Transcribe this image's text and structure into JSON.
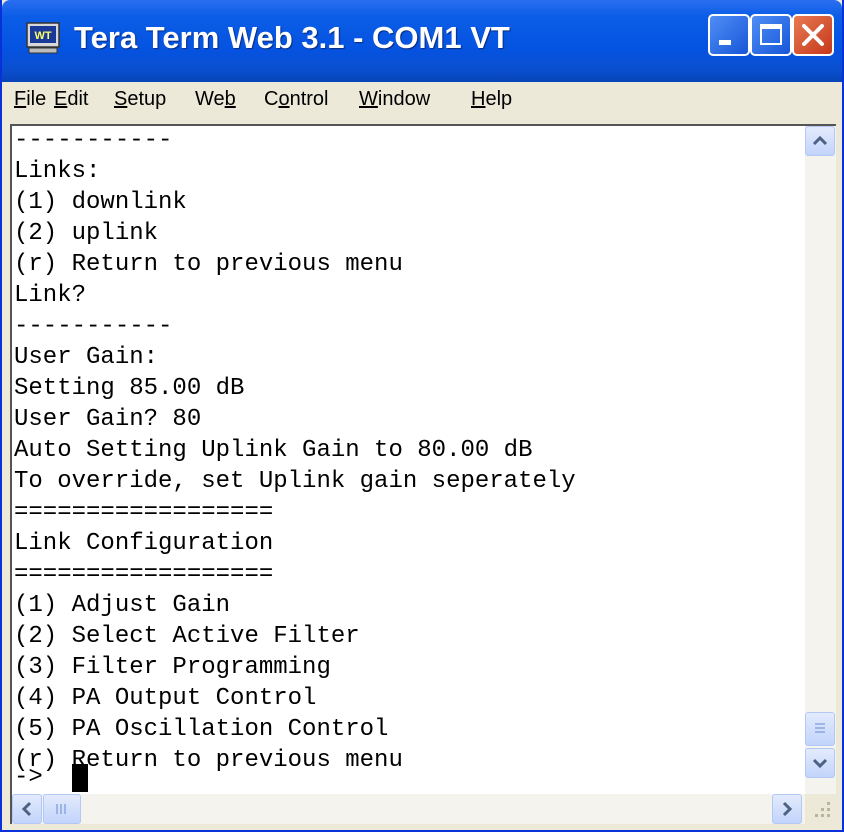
{
  "window": {
    "title": "Tera Term Web 3.1 - COM1 VT",
    "icon": "WT"
  },
  "menu": [
    {
      "pre": "",
      "ul": "F",
      "post": "ile"
    },
    {
      "pre": "",
      "ul": "E",
      "post": "dit"
    },
    {
      "pre": "",
      "ul": "S",
      "post": "etup"
    },
    {
      "pre": "We",
      "ul": "b",
      "post": ""
    },
    {
      "pre": "C",
      "ul": "o",
      "post": "ntrol"
    },
    {
      "pre": "",
      "ul": "W",
      "post": "indow"
    },
    {
      "pre": "",
      "ul": "H",
      "post": "elp"
    }
  ],
  "terminal": {
    "lines": [
      "-----------",
      "Links:",
      "(1) downlink",
      "(2) uplink",
      "(r) Return to previous menu",
      "Link?",
      "-----------",
      "User Gain:",
      "Setting 85.00 dB",
      "User Gain? 80",
      "Auto Setting Uplink Gain to 80.00 dB",
      "To override, set Uplink gain seperately",
      "==================",
      "Link Configuration",
      "==================",
      "(1) Adjust Gain",
      "(2) Select Active Filter",
      "(3) Filter Programming",
      "(4) PA Output Control",
      "(5) PA Oscillation Control",
      "(r) Return to previous menu",
      "-> "
    ]
  },
  "colors": {
    "titlebar": "#0553e1",
    "close": "#c5381c",
    "chrome": "#ece9d8"
  }
}
